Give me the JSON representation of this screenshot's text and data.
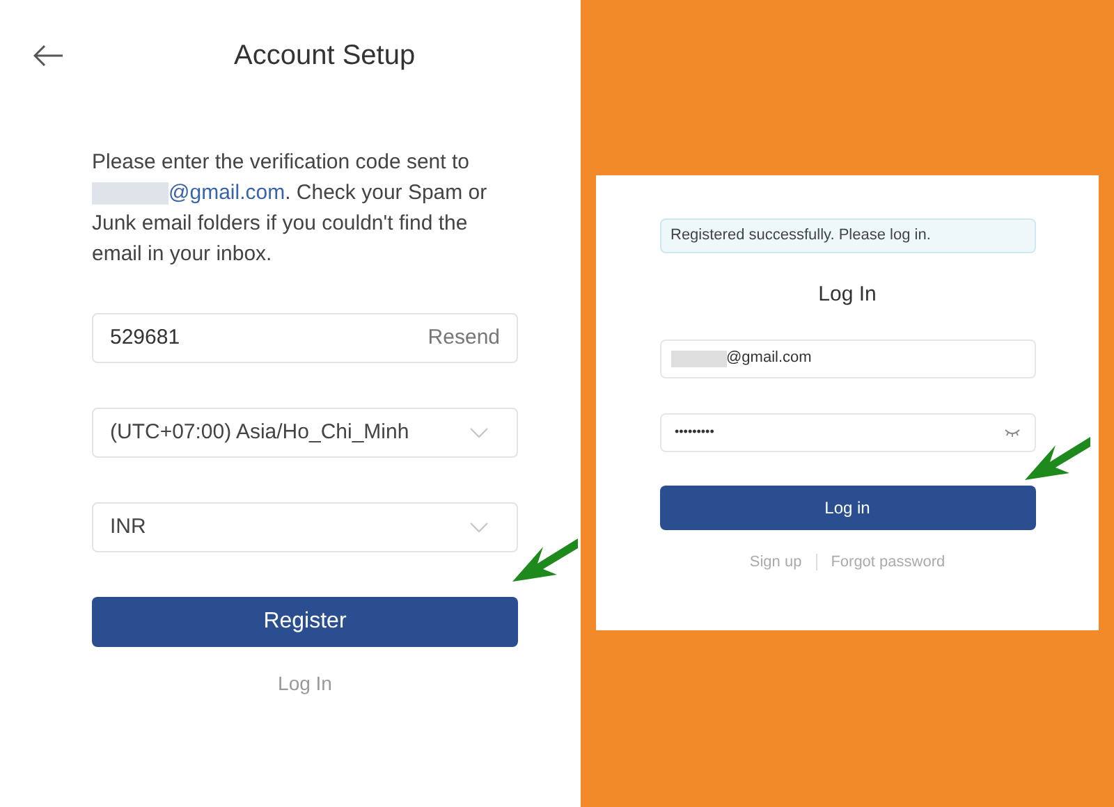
{
  "setup": {
    "title": "Account Setup",
    "intro": {
      "before": "Please enter the verification code sent to",
      "email": "@gmail.com",
      "after": ". Check your Spam or Junk email folders if you couldn't find the email in your inbox."
    },
    "fields": [
      {
        "kind": "code",
        "value": "529681",
        "action": "Resend"
      },
      {
        "kind": "select",
        "value": "(UTC+07:00) Asia/Ho_Chi_Minh"
      },
      {
        "kind": "select",
        "value": "INR"
      }
    ],
    "button": "Register",
    "link": "Log In"
  },
  "login": {
    "alert": "Registered successfully. Please log in.",
    "title": "Log In",
    "email": "@gmail.com",
    "password": "•••••••••",
    "button": "Log in",
    "links": [
      "Sign up",
      "Forgot password"
    ]
  }
}
